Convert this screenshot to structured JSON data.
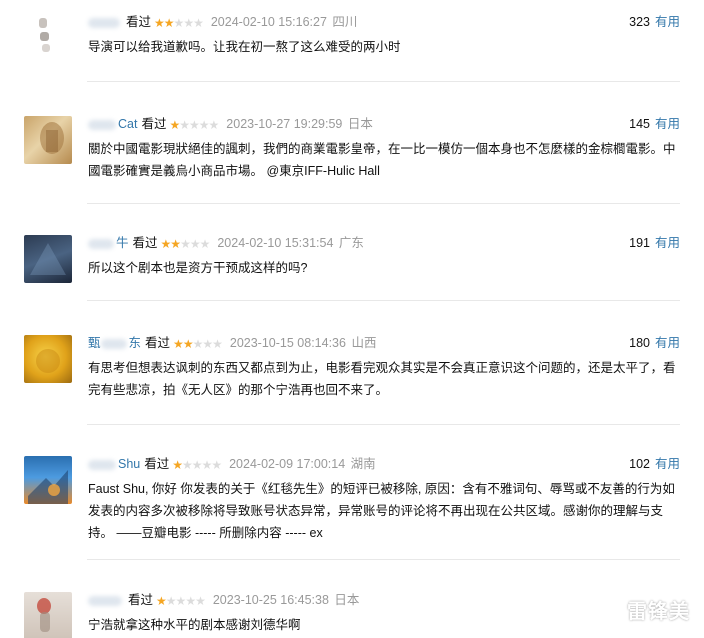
{
  "useful_label": "有用",
  "comments": [
    {
      "user": "",
      "seen": "看过",
      "rating": 2,
      "time": "2024-02-10 15:16:27",
      "location": "四川",
      "votes": "323",
      "text": "导演可以给我道歉吗。让我在初一熬了这么难受的两小时"
    },
    {
      "user": "Cat",
      "seen": "看过",
      "rating": 1,
      "time": "2023-10-27 19:29:59",
      "location": "日本",
      "votes": "145",
      "text": "關於中國電影現狀絕佳的諷刺，我們的商業電影皇帝，在一比一模仿一個本身也不怎麼樣的金棕櫚電影。中國電影確實是義烏小商品市場。 @東京IFF-Hulic Hall"
    },
    {
      "user": "牛",
      "seen": "看过",
      "rating": 2,
      "time": "2024-02-10 15:31:54",
      "location": "广东",
      "votes": "191",
      "text": "所以这个剧本也是资方干预成这样的吗?"
    },
    {
      "user": "东",
      "user_prefix": "甄",
      "seen": "看过",
      "rating": 2,
      "time": "2023-10-15 08:14:36",
      "location": "山西",
      "votes": "180",
      "text": "有思考但想表达讽刺的东西又都点到为止，电影看完观众其实是不会真正意识这个问题的，还是太平了，看完有些悲凉，拍《无人区》的那个宁浩再也回不来了。"
    },
    {
      "user": "Shu",
      "seen": "看过",
      "rating": 1,
      "time": "2024-02-09 17:00:14",
      "location": "湖南",
      "votes": "102",
      "text": "Faust Shu, 你好 你发表的关于《红毯先生》的短评已被移除, 原因：含有不雅词句、辱骂或不友善的行为如发表的内容多次被移除将导致账号状态异常，异常账号的评论将不再出现在公共区域。感谢你的理解与支持。 ——豆瓣电影 ----- 所删除内容 ----- ex"
    },
    {
      "user": "",
      "seen": "看过",
      "rating": 1,
      "time": "2023-10-25 16:45:38",
      "location": "日本",
      "votes": "",
      "text": "宁浩就拿这种水平的剧本感谢刘德华啊"
    }
  ],
  "watermark": "雷锋美",
  "colors": {
    "link": "#3377aa",
    "star_on": "#f5a623",
    "star_off": "#dcdcdc",
    "time": "#999999",
    "divider": "#e8e8e8"
  }
}
